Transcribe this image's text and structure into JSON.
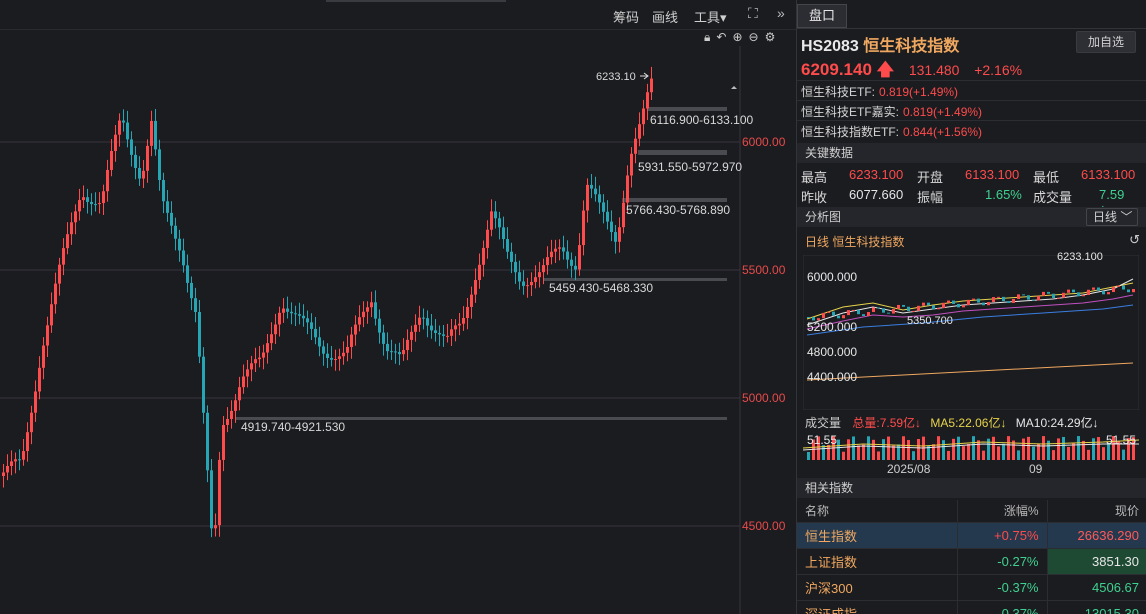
{
  "toolbar": {
    "chips": "筹码",
    "draw": "画线",
    "tools": "工具▾",
    "fullscreen_icon": "expand-icon",
    "more_icon": "double-chevron-icon"
  },
  "chart": {
    "price_axis": [
      "6000.00",
      "5500.00",
      "5000.00",
      "4500.00"
    ],
    "high_label": "6233.10",
    "ranges": [
      "6116.900-6133.100",
      "5931.550-5972.970",
      "5766.430-5768.890",
      "5459.430-5468.330",
      "4919.740-4921.530"
    ]
  },
  "panel": {
    "tab": "盘口",
    "code": "HS2083",
    "name": "恒生科技指数",
    "add_button": "加自选",
    "price": "6209.140",
    "change": "131.480",
    "change_pct": "+2.16%",
    "etfs": [
      {
        "name": "恒生科技ETF:",
        "value": "0.819(+1.49%)"
      },
      {
        "name": "恒生科技ETF嘉实:",
        "value": "0.819(+1.49%)"
      },
      {
        "name": "恒生科技指数ETF:",
        "value": "0.844(+1.56%)"
      }
    ],
    "key_data_title": "关键数据",
    "key": {
      "high_l": "最高",
      "high_v": "6233.100",
      "open_l": "开盘",
      "open_v": "6133.100",
      "low_l": "最低",
      "low_v": "6133.100",
      "prev_l": "昨收",
      "prev_v": "6077.660",
      "amp_l": "振幅",
      "amp_v": "1.65%",
      "vol_l": "成交量",
      "vol_v": "7.59亿"
    },
    "analysis_title": "分析图",
    "period": "日线 ﹀",
    "mini_title": "日线  恒生科技指数",
    "mini_axis": [
      "6000.000",
      "5200.000",
      "4800.000",
      "4400.000"
    ],
    "mini_high": "6233.100",
    "mini_low": "5350.700",
    "vol_legend": {
      "label": "成交量",
      "total": "总量:7.59亿↓",
      "ma5": "MA5:22.06亿↓",
      "ma10": "MA10:24.29亿↓"
    },
    "vol_left": "51.55",
    "vol_right": "51.55",
    "dates": [
      "2025/08",
      "09"
    ],
    "related_title": "相关指数",
    "related_headers": [
      "名称",
      "涨幅%",
      "现价"
    ],
    "related": [
      {
        "name": "恒生指数",
        "pct": "+0.75%",
        "price": "26636.290"
      },
      {
        "name": "上证指数",
        "pct": "-0.27%",
        "price": "3851.30"
      },
      {
        "name": "沪深300",
        "pct": "-0.37%",
        "price": "4506.67"
      },
      {
        "name": "深证成指",
        "pct": "-0.37%",
        "price": "13015.30"
      }
    ]
  },
  "colors": {
    "up": "#ff4b4b",
    "down": "#26a6b4",
    "accent": "#f0a860"
  }
}
